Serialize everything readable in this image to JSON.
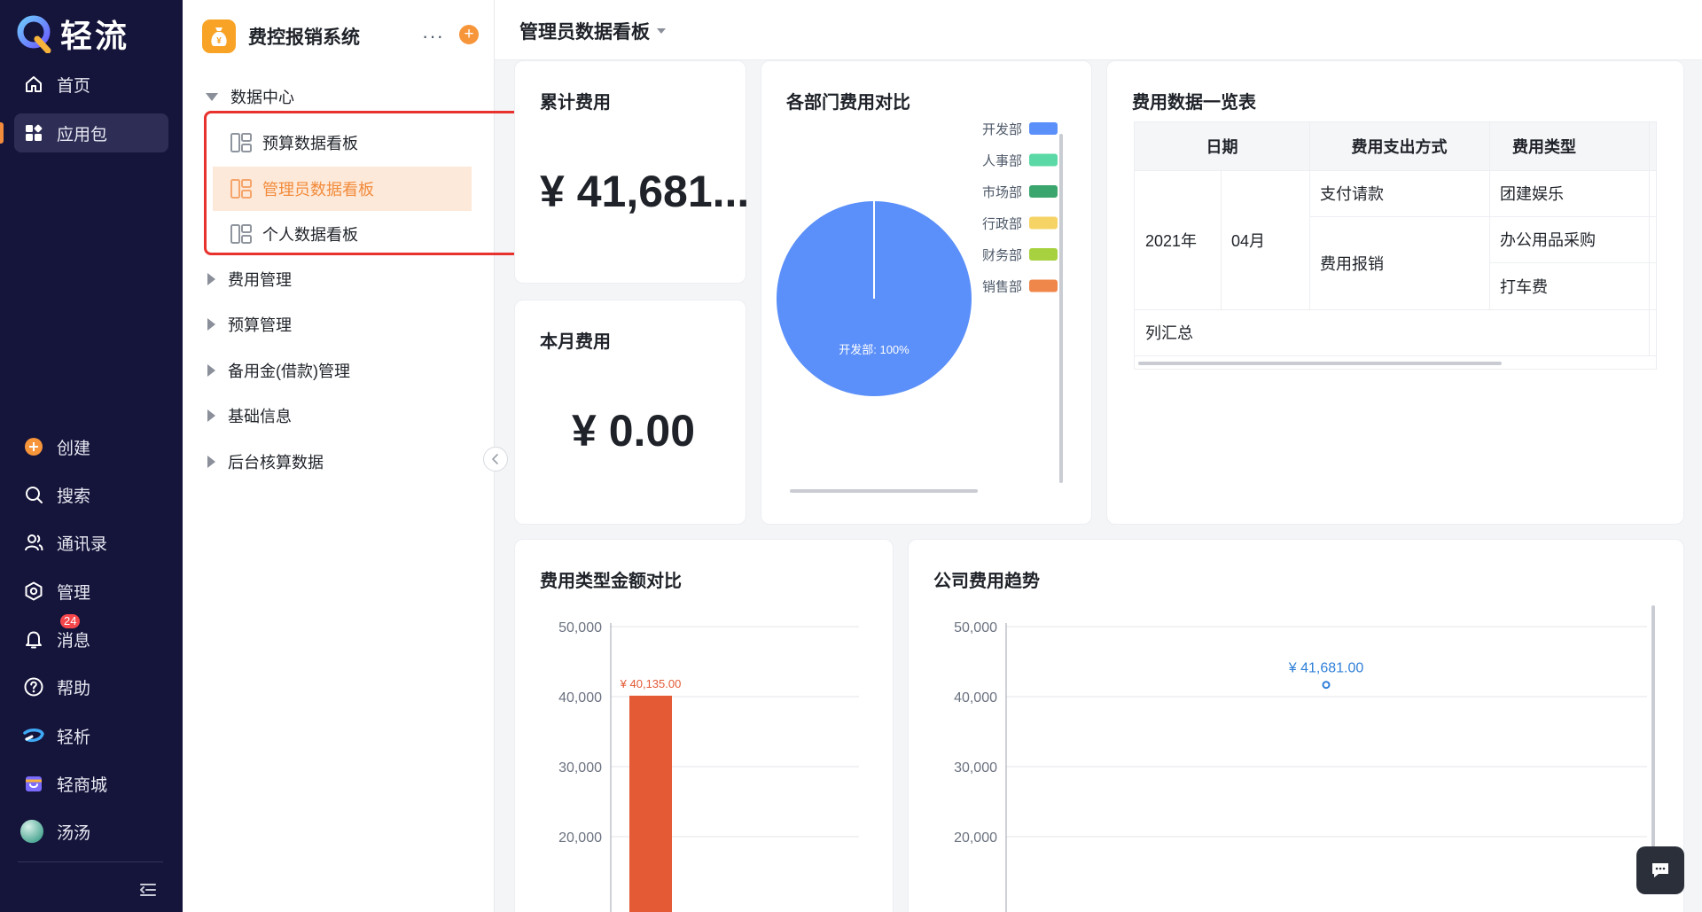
{
  "brand": {
    "name": "轻流"
  },
  "nav": {
    "items": [
      {
        "label": "首页",
        "icon": "home-icon"
      },
      {
        "label": "应用包",
        "icon": "apps-icon"
      },
      {
        "label": "创建",
        "icon": "plus-circle-icon"
      },
      {
        "label": "搜索",
        "icon": "search-icon"
      },
      {
        "label": "通讯录",
        "icon": "contacts-icon"
      },
      {
        "label": "管理",
        "icon": "gear-icon"
      },
      {
        "label": "消息",
        "icon": "bell-icon",
        "badge": "24"
      },
      {
        "label": "帮助",
        "icon": "help-icon"
      },
      {
        "label": "轻析",
        "icon": "qingxi-logo-icon"
      },
      {
        "label": "轻商城",
        "icon": "store-icon"
      },
      {
        "label": "汤汤",
        "icon": "avatar"
      }
    ]
  },
  "app": {
    "title": "费控报销系统",
    "tree": {
      "open_group": "数据中心",
      "leaves": [
        "预算数据看板",
        "管理员数据看板",
        "个人数据看板"
      ],
      "active_leaf": "管理员数据看板",
      "groups": [
        "费用管理",
        "预算管理",
        "备用金(借款)管理",
        "基础信息",
        "后台核算数据"
      ]
    }
  },
  "page": {
    "title": "管理员数据看板"
  },
  "cards": {
    "total": {
      "title": "累计费用",
      "value": "¥ 41,681..."
    },
    "month": {
      "title": "本月费用",
      "value": "¥ 0.00"
    },
    "dept": {
      "title": "各部门费用对比"
    },
    "table": {
      "title": "费用数据一览表"
    },
    "type": {
      "title": "费用类型金额对比"
    },
    "trend": {
      "title": "公司费用趋势"
    }
  },
  "table": {
    "headers": [
      "日期",
      "费用支出方式",
      "费用类型"
    ],
    "year": "2021年",
    "month": "04月",
    "methods": [
      "支付请款",
      "费用报销"
    ],
    "types": [
      "团建娱乐",
      "办公用品采购",
      "打车费"
    ],
    "footer": "列汇总"
  },
  "chart_data": [
    {
      "type": "pie",
      "legend_position": "right",
      "categories": [
        "开发部",
        "人事部",
        "市场部",
        "行政部",
        "财务部",
        "销售部"
      ],
      "colors": [
        "#5b8ff9",
        "#5ad8a6",
        "#3aa66d",
        "#f6d365",
        "#a8d13f",
        "#f0874a"
      ],
      "values": [
        100,
        0,
        0,
        0,
        0,
        0
      ],
      "labels": [
        "开发部: 100%"
      ]
    },
    {
      "type": "bar",
      "categories": [
        ""
      ],
      "values": [
        40135.0
      ],
      "data_labels": [
        "¥ 40,135.00"
      ],
      "color": "#e35a35",
      "ylim": [
        20000,
        50000
      ],
      "yticks": [
        "20,000",
        "30,000",
        "40,000",
        "50,000"
      ],
      "ytick_values": [
        20000,
        30000,
        40000,
        50000
      ]
    },
    {
      "type": "line",
      "x": [
        ""
      ],
      "values": [
        41681.0
      ],
      "data_labels": [
        "¥ 41,681.00"
      ],
      "color": "#2f7fd8",
      "ylim": [
        20000,
        50000
      ],
      "yticks": [
        "20,000",
        "30,000",
        "40,000",
        "50,000"
      ],
      "ytick_values": [
        20000,
        30000,
        40000,
        50000
      ]
    }
  ]
}
